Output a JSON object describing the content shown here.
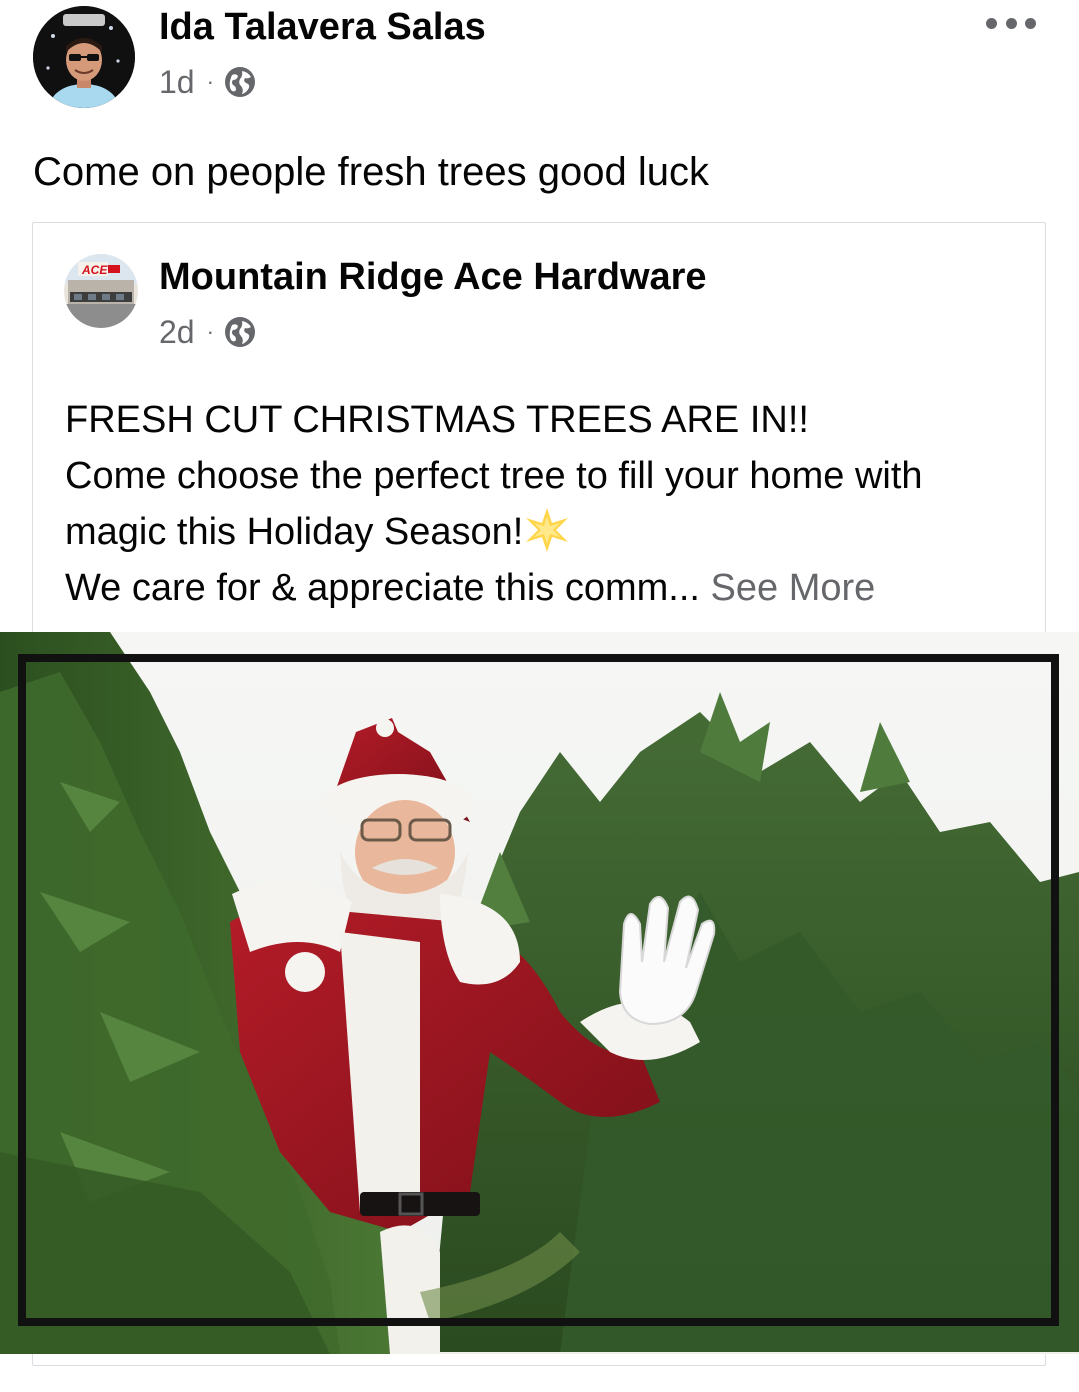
{
  "post": {
    "author": "Ida Talavera Salas",
    "time": "1d",
    "separator": "·",
    "text": "Come on people fresh trees good luck"
  },
  "shared": {
    "page_name": "Mountain Ridge Ace Hardware",
    "time": "2d",
    "separator": "·",
    "body_line1": "FRESH CUT CHRISTMAS TREES ARE IN!!",
    "body_line2": "Come choose the perfect tree to fill your home with",
    "body_line3": "magic this Holiday Season!",
    "body_line4": "We care for & appreciate this comm...",
    "see_more": " See More",
    "avatar_logo_text": "ACE"
  },
  "icons": {
    "more": "more-options-icon",
    "privacy": "globe-icon",
    "emoji": "star-emoji-icon"
  },
  "colors": {
    "primary_text": "#050505",
    "secondary_text": "#65676b",
    "border": "#dadde1",
    "ace_red": "#d4111c",
    "santa_red": "#9b1420",
    "tree_green": "#2f5a24"
  }
}
